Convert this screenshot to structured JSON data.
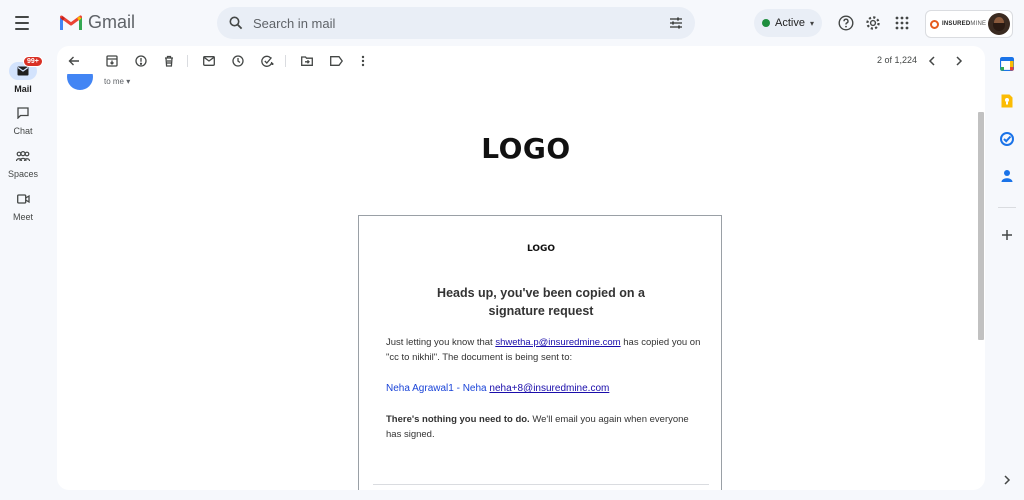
{
  "header": {
    "app_name": "Gmail",
    "search_placeholder": "Search in mail",
    "status_label": "Active",
    "brand_name_bold": "INSURED",
    "brand_name_thin": "MINE"
  },
  "rail": {
    "items": [
      {
        "label": "Mail",
        "icon": "mail-icon",
        "badge": "99+",
        "active": true
      },
      {
        "label": "Chat",
        "icon": "chat-icon"
      },
      {
        "label": "Spaces",
        "icon": "spaces-icon"
      },
      {
        "label": "Meet",
        "icon": "meet-icon"
      }
    ]
  },
  "toolbar": {
    "pager_text": "2 of 1,224"
  },
  "email": {
    "to_label": "to me",
    "logo_text": "LOGO",
    "card": {
      "logo_text": "LOGO",
      "heading_line1": "Heads up, you've been copied on a",
      "heading_line2": "signature request",
      "para1_before": "Just letting you know that ",
      "para1_email": "shwetha.p@insuredmine.com",
      "para1_after": " has copied you on \"cc to nikhil\". The document is being sent to:",
      "recipient_name": "Neha Agrawal1 - Neha ",
      "recipient_email": "neha+8@insuredmine.com",
      "para3_bold": "There's nothing you need to do.",
      "para3_rest": " We'll email you again when everyone has signed."
    }
  },
  "colors": {
    "background": "#f6f8fc",
    "search_bg": "#e9eef6",
    "active_green": "#1e8e3e",
    "badge_red": "#d93025",
    "link_blue": "#1a0dab"
  }
}
